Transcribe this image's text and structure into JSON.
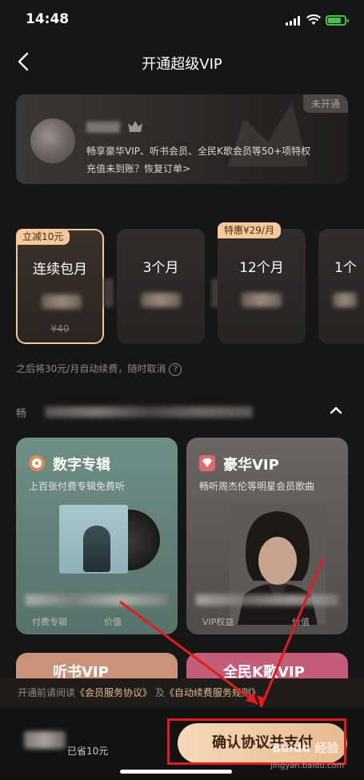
{
  "status_bar": {
    "time": "14:48",
    "icons": [
      "signal-icon",
      "wifi-icon",
      "battery-charging-icon"
    ]
  },
  "nav": {
    "title": "开通超级VIP",
    "back_icon": "chevron-left-icon"
  },
  "member_card": {
    "badge": "未开通",
    "description": "畅享豪华VIP、听书会员、全民K歌会员等50+项特权",
    "link": "充值未到账？恢复订单>"
  },
  "plans": [
    {
      "name": "连续包月",
      "tag": "立减10元",
      "original_price": "¥40",
      "selected": true
    },
    {
      "name": "3个月",
      "tag": "",
      "original_price": "",
      "selected": false
    },
    {
      "name": "12个月",
      "tag": "特惠¥29/月",
      "original_price": "",
      "selected": false
    },
    {
      "name": "1个",
      "tag": "",
      "original_price": "",
      "selected": false
    }
  ],
  "renew_note": "之后将30元/月自动续费，随时取消",
  "section": {
    "title": "畅"
  },
  "benefits": [
    {
      "title": "数字专辑",
      "subtitle": "上百张付费专辑免费听",
      "labels": [
        "付费专辑",
        "价值"
      ],
      "icon": "disc-icon",
      "color": "#e08a5a"
    },
    {
      "title": "豪华VIP",
      "subtitle": "畅听周杰伦等明星会员歌曲",
      "labels": [
        "VIP权益",
        "价值"
      ],
      "icon": "heart-diamond-icon",
      "color": "#e06a6a"
    }
  ],
  "benefits_row2": [
    {
      "title": "听书VIP"
    },
    {
      "title": "全民K歌VIP"
    }
  ],
  "agreement": {
    "prefix": "开通前请阅读",
    "link1": "《会员服务协议》",
    "middle": " 及",
    "link2": "《自动续费服务规则》"
  },
  "bottom": {
    "savings": "已省10元",
    "pay_label": "确认协议并支付"
  },
  "watermark": {
    "badge": "Baidu 经验",
    "url": "jingyan.baidu.com"
  }
}
